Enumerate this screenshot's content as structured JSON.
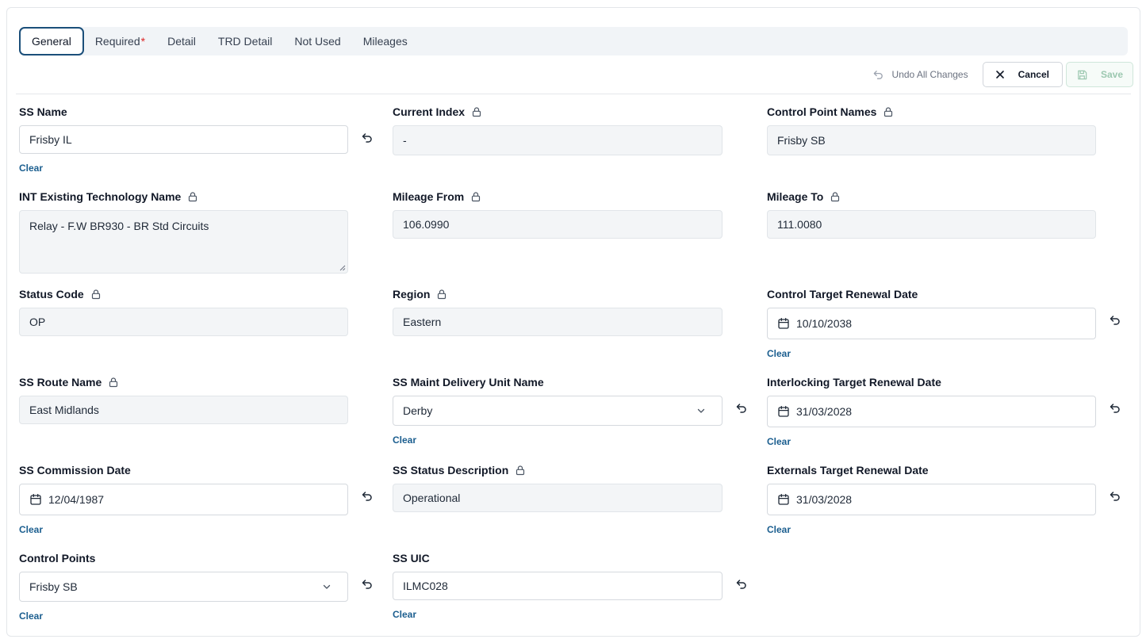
{
  "tabs": [
    {
      "label": "General",
      "active": true
    },
    {
      "label": "Required",
      "required_marker": "*"
    },
    {
      "label": "Detail"
    },
    {
      "label": "TRD Detail"
    },
    {
      "label": "Not Used"
    },
    {
      "label": "Mileages"
    }
  ],
  "toolbar": {
    "undo_all_label": "Undo All Changes",
    "cancel_label": "Cancel",
    "save_label": "Save"
  },
  "clear_label": "Clear",
  "fields": {
    "ss_name": {
      "label": "SS Name",
      "value": "Frisby IL"
    },
    "current_index": {
      "label": "Current Index",
      "value": "-"
    },
    "control_point_names": {
      "label": "Control Point Names",
      "value": "Frisby SB"
    },
    "int_existing_technology_name": {
      "label": "INT Existing Technology Name",
      "value": "Relay - F.W BR930 - BR Std Circuits"
    },
    "mileage_from": {
      "label": "Mileage From",
      "value": "106.0990"
    },
    "mileage_to": {
      "label": "Mileage To",
      "value": "111.0080"
    },
    "status_code": {
      "label": "Status Code",
      "value": "OP"
    },
    "region": {
      "label": "Region",
      "value": "Eastern"
    },
    "control_target_renewal_date": {
      "label": "Control Target Renewal Date",
      "value": "10/10/2038"
    },
    "ss_route_name": {
      "label": "SS Route Name",
      "value": "East Midlands"
    },
    "ss_maint_delivery_unit_name": {
      "label": "SS Maint Delivery Unit Name",
      "value": "Derby"
    },
    "interlocking_target_renewal_date": {
      "label": "Interlocking Target Renewal Date",
      "value": "31/03/2028"
    },
    "ss_commission_date": {
      "label": "SS Commission Date",
      "value": "12/04/1987"
    },
    "ss_status_description": {
      "label": "SS Status Description",
      "value": "Operational"
    },
    "externals_target_renewal_date": {
      "label": "Externals Target Renewal Date",
      "value": "31/03/2028"
    },
    "control_points": {
      "label": "Control Points",
      "value": "Frisby SB"
    },
    "ss_uic": {
      "label": "SS UIC",
      "value": "ILMC028"
    }
  },
  "colors": {
    "tab_active_border": "#1b4f7a",
    "clear_link": "#1b5e8f",
    "required_star": "#dc2626",
    "save_disabled": "#9cc8b0",
    "locked_field_bg": "#f3f5f7"
  },
  "icons": [
    "undo-icon",
    "close-icon",
    "save-icon",
    "lock-icon",
    "calendar-icon",
    "chevron-down-icon",
    "revert-icon"
  ]
}
